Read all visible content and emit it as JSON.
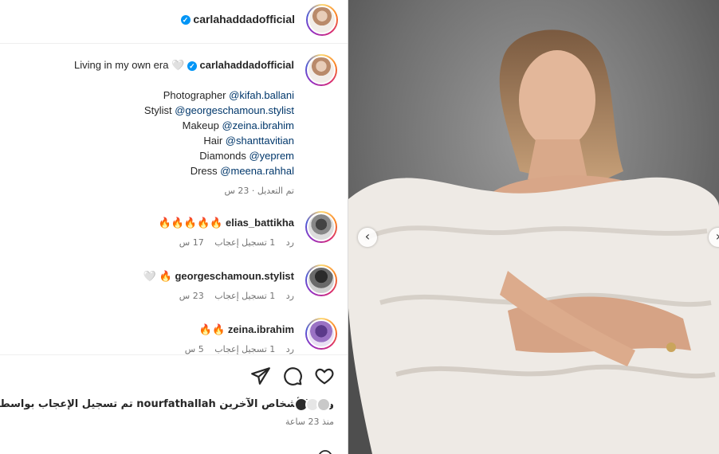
{
  "post": {
    "author": "carlahaddadofficial",
    "caption_line1": "Living in my own era 🤍",
    "credits": [
      {
        "role": "Photographer",
        "handle": "@kifah.ballani"
      },
      {
        "role": "Stylist",
        "handle": "@georgeschamoun.stylist"
      },
      {
        "role": "Makeup",
        "handle": "@zeina.ibrahim"
      },
      {
        "role": "Hair",
        "handle": "@shanttavitian"
      },
      {
        "role": "Diamonds",
        "handle": "@yeprem"
      },
      {
        "role": "Dress",
        "handle": "@meena.rahhal"
      }
    ],
    "caption_meta": "تم التعديل · 23 س"
  },
  "comments": [
    {
      "user": "elias_battikha",
      "text": "🔥🔥🔥🔥🔥",
      "time": "17 س",
      "likes": "1 تسجيل إعجاب",
      "reply": "رد"
    },
    {
      "user": "georgeschamoun.stylist",
      "text": "🤍 🔥",
      "time": "23 س",
      "likes": "1 تسجيل إعجاب",
      "reply": "رد"
    },
    {
      "user": "zeina.ibrahim",
      "text": "🔥🔥",
      "time": "5 س",
      "likes": "1 تسجيل إعجاب",
      "reply": "رد"
    }
  ],
  "footer": {
    "liked_by": "تم تسجيل الإعجاب بواسطة nourfathallah ومن الأشخاص الآخرين",
    "time_ago": "منذ 23 ساعة"
  },
  "icons": {
    "heart": "heart-icon",
    "comment": "comment-icon",
    "share": "share-icon",
    "verified": "verified-badge-icon",
    "prev": "chevron-left-icon",
    "next": "chevron-right-icon"
  },
  "colors": {
    "link": "#00376b",
    "verified": "#0095f6",
    "muted": "#737373"
  }
}
